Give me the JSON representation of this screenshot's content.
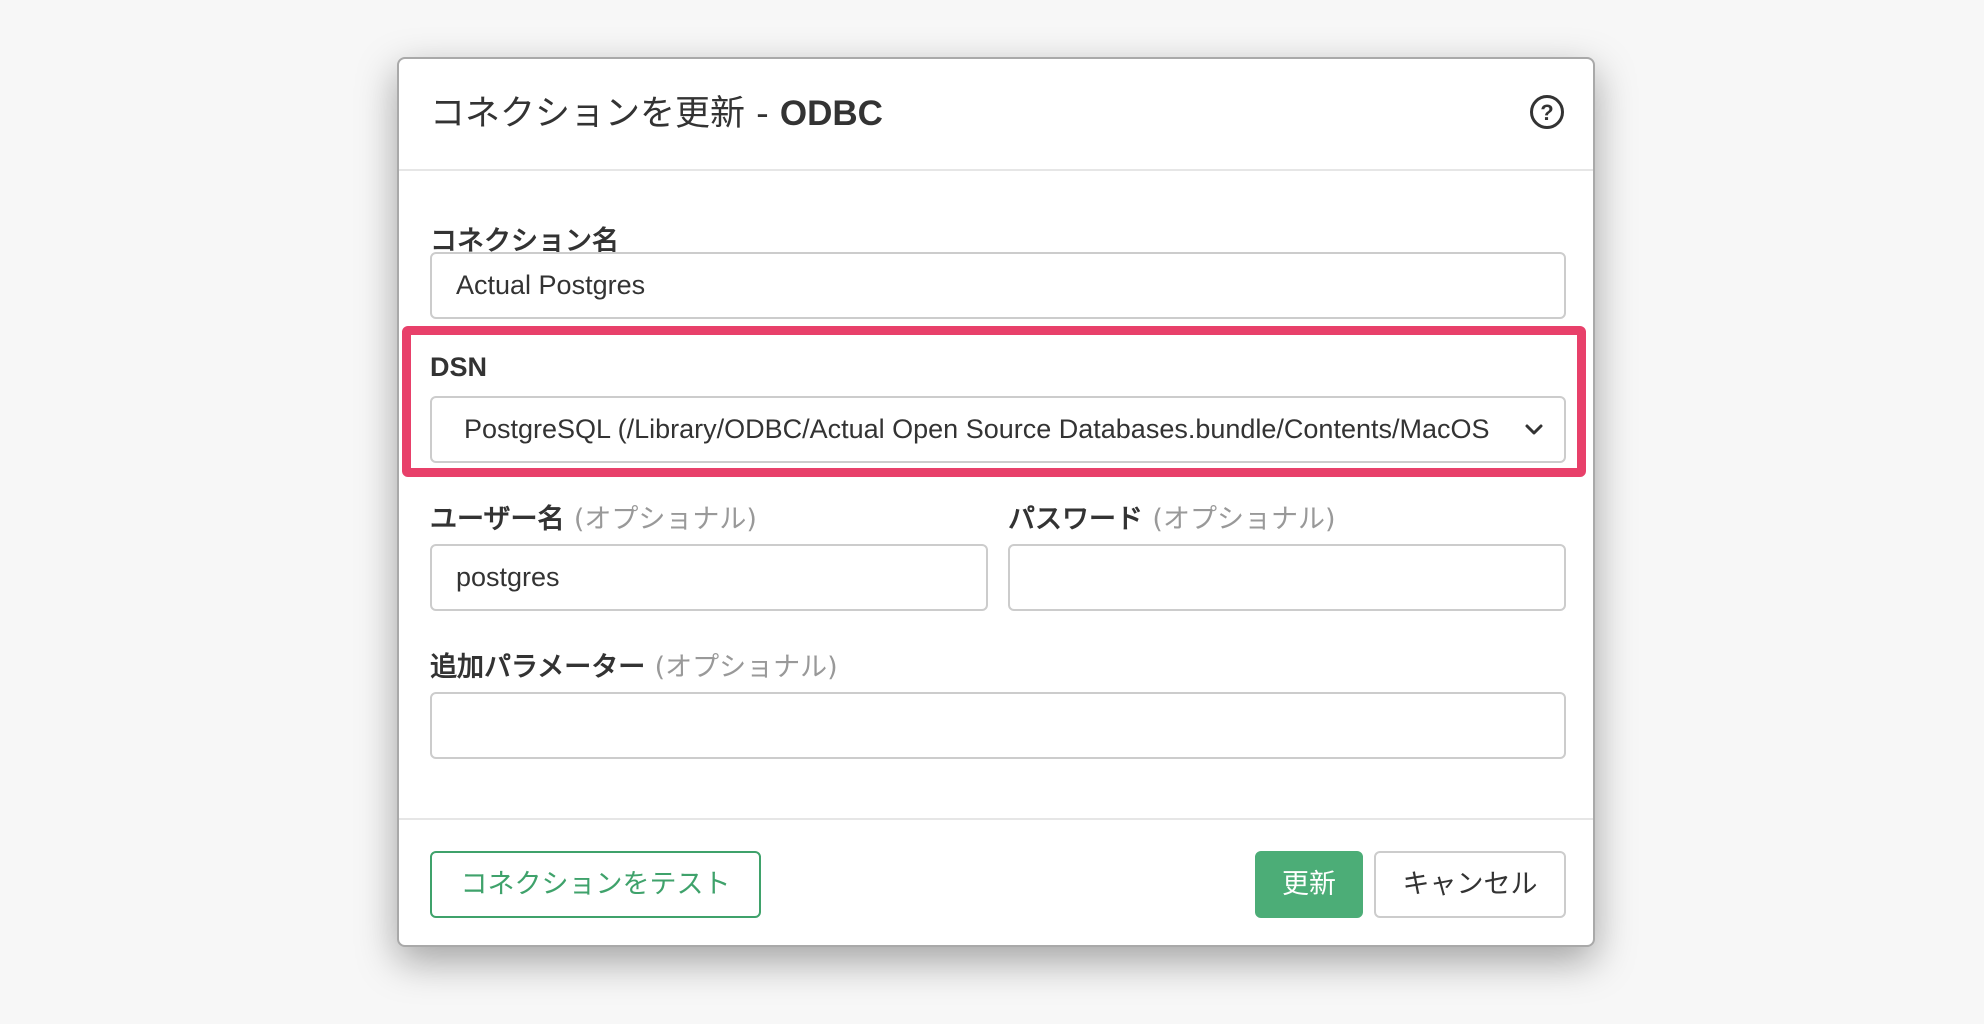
{
  "dialog": {
    "title_main": "コネクションを更新 - ",
    "title_suffix": "ODBC",
    "help_symbol": "?"
  },
  "form": {
    "connection_name": {
      "label": "コネクション名",
      "value": "Actual Postgres"
    },
    "dsn": {
      "label": "DSN",
      "selected": "PostgreSQL (/Library/ODBC/Actual Open Source Databases.bundle/Contents/MacOS"
    },
    "username": {
      "label": "ユーザー名",
      "optional": "(オプショナル)",
      "value": "postgres"
    },
    "password": {
      "label": "パスワード",
      "optional": "(オプショナル)",
      "value": ""
    },
    "extra_params": {
      "label": "追加パラメーター",
      "optional": "(オプショナル)",
      "value": ""
    }
  },
  "buttons": {
    "test_label": "コネクションをテスト",
    "update_label": "更新",
    "cancel_label": "キャンセル"
  },
  "colors": {
    "accent_green": "#4cad77",
    "highlight_pink": "#e8406a"
  },
  "icons": {
    "help": "question-circle-icon",
    "dropdown": "chevron-down-icon"
  }
}
